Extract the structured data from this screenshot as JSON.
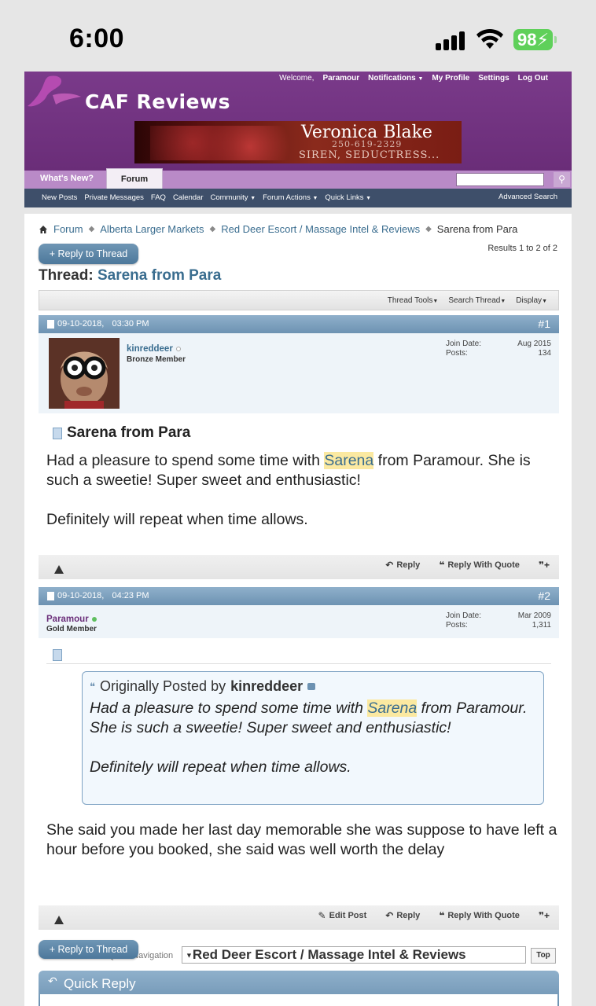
{
  "status": {
    "time": "6:00",
    "battery": "98"
  },
  "header": {
    "welcome": "Welcome,",
    "username": "Paramour",
    "links": [
      "Notifications",
      "My Profile",
      "Settings",
      "Log Out"
    ],
    "logo": "CAF Reviews",
    "banner": {
      "name": "Veronica Blake",
      "phone": "250-619-2329",
      "tagline": "SIREN, SEDUCTRESS..."
    },
    "tabs": [
      "What's New?",
      "Forum"
    ],
    "nav": [
      "New Posts",
      "Private Messages",
      "FAQ",
      "Calendar",
      "Community",
      "Forum Actions",
      "Quick Links"
    ],
    "advanced_search": "Advanced Search"
  },
  "breadcrumb": [
    "Forum",
    "Alberta Larger Markets",
    "Red Deer Escort / Massage Intel & Reviews",
    "Sarena from Para"
  ],
  "reply_thread": "+ Reply to Thread",
  "results": "Results 1 to 2 of 2",
  "thread": {
    "label": "Thread:",
    "title": "Sarena from Para"
  },
  "tools": [
    "Thread Tools",
    "Search Thread",
    "Display"
  ],
  "posts": [
    {
      "date": "09-10-2018,",
      "time": "03:30 PM",
      "number": "#1",
      "user": "kinreddeer",
      "rank": "Bronze Member",
      "join_label": "Join Date:",
      "join_date": "Aug 2015",
      "posts_label": "Posts:",
      "posts_count": "134",
      "title": "Sarena from Para",
      "text_a": "Had a pleasure to spend some time with ",
      "highlight": "Sarena",
      "text_b": " from Paramour. She is such a sweetie! Super sweet and enthusiastic!",
      "text_c": "Definitely will repeat when time allows.",
      "actions": [
        "Reply",
        "Reply With Quote"
      ]
    },
    {
      "date": "09-10-2018,",
      "time": "04:23 PM",
      "number": "#2",
      "user": "Paramour",
      "rank": "Gold Member",
      "join_label": "Join Date:",
      "join_date": "Mar 2009",
      "posts_label": "Posts:",
      "posts_count": "1,311",
      "quote": {
        "prefix": "Originally Posted by",
        "author": "kinreddeer",
        "text_a": "Had a pleasure to spend some time with ",
        "highlight": "Sarena",
        "text_b": " from Paramour. She is such a sweetie! Super sweet and enthusiastic!",
        "text_c": "Definitely will repeat when time allows."
      },
      "text": "She said you made her last day memorable she was suppose to have left a hour before you booked, she said was well worth the delay",
      "actions": [
        "Edit Post",
        "Reply",
        "Reply With Quote"
      ]
    }
  ],
  "quick_navigation": {
    "label": "Quick Navigation",
    "selected": "Red Deer Escort / Massage Intel & Reviews",
    "top": "Top"
  },
  "quick_reply": "Quick Reply",
  "colors": {
    "header_purple": "#6b2f7a",
    "nav_dark": "#3e4f6a",
    "post_head_blue": "#7a9dbd",
    "link_blue": "#3a6d8f",
    "highlight": "#fbe9a1",
    "online_green": "#5fbf5f"
  }
}
